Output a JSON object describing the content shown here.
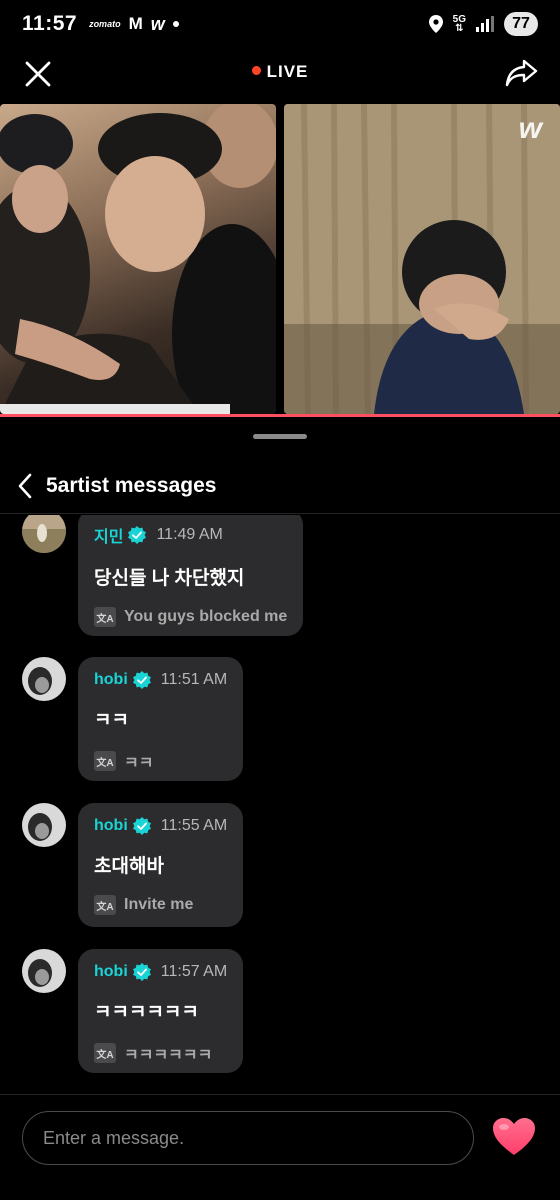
{
  "status_bar": {
    "time": "11:57",
    "zomato": "zomato",
    "gmail": "M",
    "weverse": "w",
    "network": "5G",
    "battery": "77"
  },
  "live_header": {
    "live_label": "LIVE",
    "live_dot_color": "#ff4528"
  },
  "video_tiles": {
    "watermark": "w"
  },
  "sheet": {
    "title": "5artist messages"
  },
  "messages": [
    {
      "sender": "지민",
      "time": "11:49 AM",
      "text": "당신들 나 차단했지",
      "translation": "You guys blocked me"
    },
    {
      "sender": "hobi",
      "time": "11:51 AM",
      "text": "ㅋㅋ",
      "translation": "ㅋㅋ"
    },
    {
      "sender": "hobi",
      "time": "11:55 AM",
      "text": "초대해바",
      "translation": "Invite me"
    },
    {
      "sender": "hobi",
      "time": "11:57 AM",
      "text": "ㅋㅋㅋㅋㅋㅋ",
      "translation": "ㅋㅋㅋㅋㅋㅋ"
    }
  ],
  "translate_icon_label": "文A",
  "input": {
    "placeholder": "Enter a message."
  },
  "colors": {
    "accent_sender": "#19d3d5",
    "heart": "#ff4f78",
    "bubble": "#2c2c2e"
  }
}
